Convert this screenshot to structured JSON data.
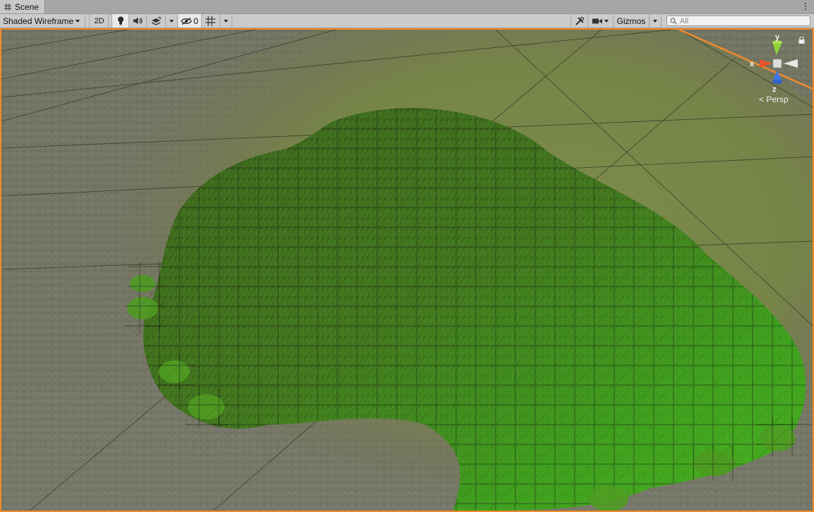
{
  "tab": {
    "title": "Scene",
    "icon": "grid-icon"
  },
  "toolbar": {
    "draw_mode": "Shaded Wireframe",
    "toggle_2d": "2D",
    "hidden_count": "0",
    "gizmos_label": "Gizmos",
    "search_placeholder": "All"
  },
  "gizmo": {
    "axis_x": "x",
    "axis_y": "y",
    "axis_z": "z",
    "projection": "< Persp",
    "colors": {
      "x": "#e2552a",
      "y": "#8fd13c",
      "z": "#3a78e6"
    }
  },
  "colors": {
    "accent_border": "#f08a2c",
    "ground": "#7c7c6e",
    "grass_dark": "#3f6a1c",
    "grass_light": "#39a51a"
  }
}
